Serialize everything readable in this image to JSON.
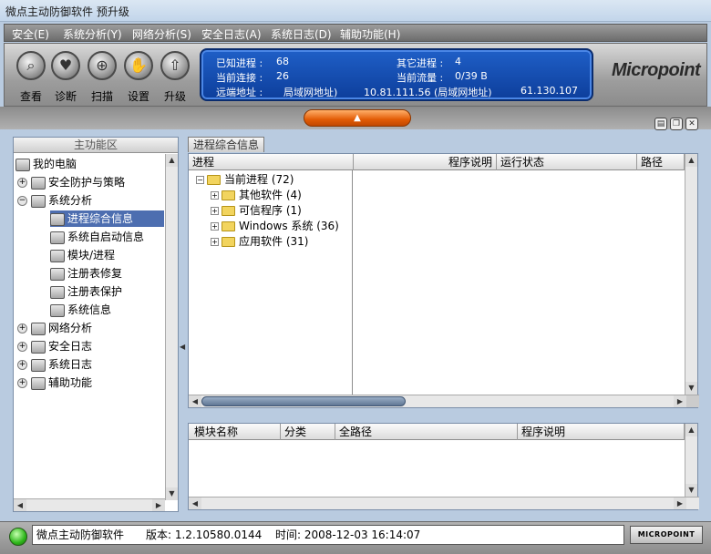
{
  "window": {
    "title": "微点主动防御软件  预升级"
  },
  "menu": [
    "安全(E)",
    "系统分析(Y)",
    "网络分析(S)",
    "安全日志(A)",
    "系统日志(D)",
    "辅助功能(H)"
  ],
  "toolbar": {
    "buttons": [
      {
        "label": "查看",
        "icon": "magnifier-icon"
      },
      {
        "label": "诊断",
        "icon": "heart-icon"
      },
      {
        "label": "扫描",
        "icon": "scan-icon"
      },
      {
        "label": "设置",
        "icon": "hand-icon"
      },
      {
        "label": "升级",
        "icon": "upgrade-icon"
      }
    ]
  },
  "info": {
    "known_label": "已知进程 :",
    "known_value": "68",
    "other_label": "其它进程 :",
    "other_value": "4",
    "conn_label": "当前连接 :",
    "conn_value": "26",
    "traffic_label": "当前流量 :",
    "traffic_value": "0/39 B",
    "remote_label": "远端地址 :",
    "lan_label1": "局域网地址)",
    "ip1": "10.81.111.56 (局域网地址)",
    "ip2": "61.130.107"
  },
  "logo": "Micropoint",
  "left": {
    "header": "主功能区",
    "items": [
      {
        "label": "我的电脑"
      },
      {
        "label": "安全防护与策略"
      },
      {
        "label": "系统分析"
      },
      {
        "label": "进程综合信息"
      },
      {
        "label": "系统自启动信息"
      },
      {
        "label": "模块/进程"
      },
      {
        "label": "注册表修复"
      },
      {
        "label": "注册表保护"
      },
      {
        "label": "系统信息"
      },
      {
        "label": "网络分析"
      },
      {
        "label": "安全日志"
      },
      {
        "label": "系统日志"
      },
      {
        "label": "辅助功能"
      }
    ]
  },
  "tab": "进程综合信息",
  "process_table": {
    "columns": [
      "进程",
      "程序说明",
      "运行状态",
      "路径"
    ],
    "root": "当前进程 (72)",
    "groups": [
      "其他软件 (4)",
      "可信程序 (1)",
      "Windows 系统 (36)",
      "应用软件 (31)"
    ]
  },
  "module_table": {
    "columns": [
      "模块名称",
      "分类",
      "全路径",
      "程序说明"
    ]
  },
  "status": {
    "app": "微点主动防御软件",
    "version": "版本: 1.2.10580.0144",
    "time": "时间: 2008-12-03 16:14:07",
    "brand": "MICROPOINT"
  }
}
